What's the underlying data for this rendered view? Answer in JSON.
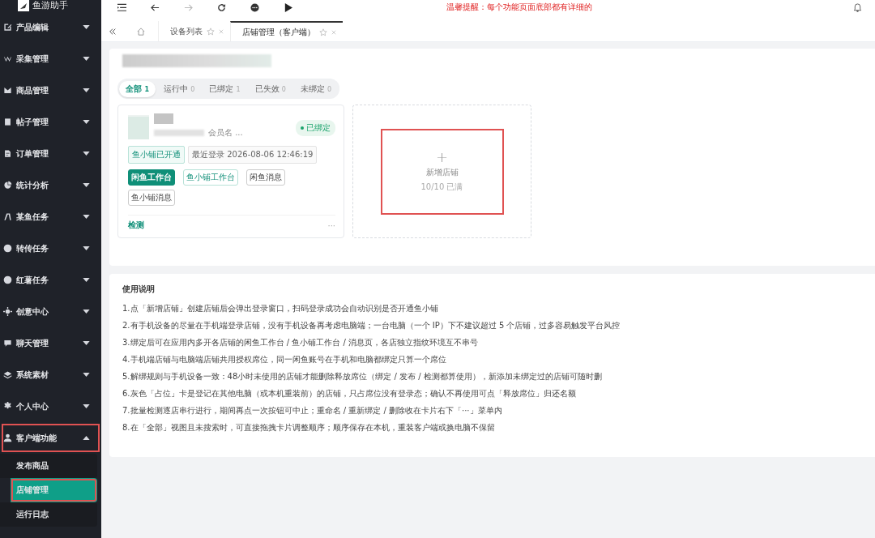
{
  "app": {
    "name": "鱼游助手"
  },
  "sidebar": {
    "items": [
      {
        "label": "产品编辑",
        "expanded": false,
        "highlighted": false
      },
      {
        "label": "采集管理",
        "expanded": false,
        "highlighted": false
      },
      {
        "label": "商品管理",
        "expanded": false,
        "highlighted": false
      },
      {
        "label": "帖子管理",
        "expanded": false,
        "highlighted": false
      },
      {
        "label": "订单管理",
        "expanded": false,
        "highlighted": false
      },
      {
        "label": "统计分析",
        "expanded": false,
        "highlighted": false
      },
      {
        "label": "某鱼任务",
        "expanded": false,
        "highlighted": false
      },
      {
        "label": "转传任务",
        "expanded": false,
        "highlighted": false
      },
      {
        "label": "红薯任务",
        "expanded": false,
        "highlighted": false
      },
      {
        "label": "创意中心",
        "expanded": false,
        "highlighted": false
      },
      {
        "label": "聊天管理",
        "expanded": false,
        "highlighted": false
      },
      {
        "label": "系统素材",
        "expanded": false,
        "highlighted": false
      },
      {
        "label": "个人中心",
        "expanded": false,
        "highlighted": false
      },
      {
        "label": "客户端功能",
        "expanded": true,
        "highlighted": true,
        "children": [
          {
            "label": "发布商品",
            "selected": false,
            "highlighted": false
          },
          {
            "label": "店铺管理",
            "selected": true,
            "highlighted": true
          },
          {
            "label": "运行日志",
            "selected": false,
            "highlighted": false
          }
        ]
      }
    ]
  },
  "toolbar": {
    "notice": "温馨提醒：每个功能页面底部都有详细的"
  },
  "tabs": [
    {
      "label": "设备列表",
      "selected": false
    },
    {
      "label": "店铺管理（客户端）",
      "selected": true
    }
  ],
  "filters": [
    {
      "label": "全部",
      "count": "1",
      "selected": true
    },
    {
      "label": "运行中",
      "count": "0",
      "selected": false
    },
    {
      "label": "已绑定",
      "count": "1",
      "selected": false
    },
    {
      "label": "已失效",
      "count": "0",
      "selected": false
    },
    {
      "label": "未绑定",
      "count": "0",
      "selected": false
    }
  ],
  "store_card": {
    "member": "会员名 ...",
    "status": "已绑定",
    "tags": [
      {
        "label": "鱼小铺已开通",
        "kind": "green"
      },
      {
        "label": "最近登录 2026-08-06 12:46:19",
        "kind": "gray"
      }
    ],
    "buttons": [
      {
        "label": "闲鱼工作台",
        "kind": "filled"
      },
      {
        "label": "鱼小铺工作台",
        "kind": "outline"
      },
      {
        "label": "闲鱼消息",
        "kind": "plain"
      },
      {
        "label": "鱼小铺消息",
        "kind": "plain"
      }
    ],
    "check": "检测",
    "more": "···"
  },
  "add_card": {
    "plus": "+",
    "label": "新增店铺",
    "quota": "10/10 已满",
    "highlighted": true
  },
  "instructions": {
    "title": "使用说明",
    "lines": [
      "1.点「新增店铺」创建店铺后会弹出登录窗口，扫码登录成功会自动识别是否开通鱼小铺",
      "2.有手机设备的尽量在手机端登录店铺，没有手机设备再考虑电脑端；一台电脑（一个 IP）下不建议超过 5 个店铺，过多容易触发平台风控",
      "3.绑定后可在应用内多开各店铺的闲鱼工作台 / 鱼小铺工作台 / 消息页，各店独立指纹环境互不串号",
      "4.手机端店铺与电脑端店铺共用授权席位，同一闲鱼账号在手机和电脑都绑定只算一个席位",
      "5.解绑规则与手机设备一致：48小时未使用的店铺才能删除释放席位（绑定 / 发布 / 检测都算使用），新添加未绑定过的店铺可随时删",
      "6.灰色「占位」卡是登记在其他电脑（或本机重装前）的店铺，只占席位没有登录态；确认不再使用可点「释放席位」归还名额",
      "7.批量检测逐店串行进行，期间再点一次按钮可中止；重命名 / 重新绑定 / 删除收在卡片右下「···」菜单内",
      "8.在「全部」视图且未搜索时，可直接拖拽卡片调整顺序；顺序保存在本机，重装客户端或换电脑不保留"
    ]
  }
}
